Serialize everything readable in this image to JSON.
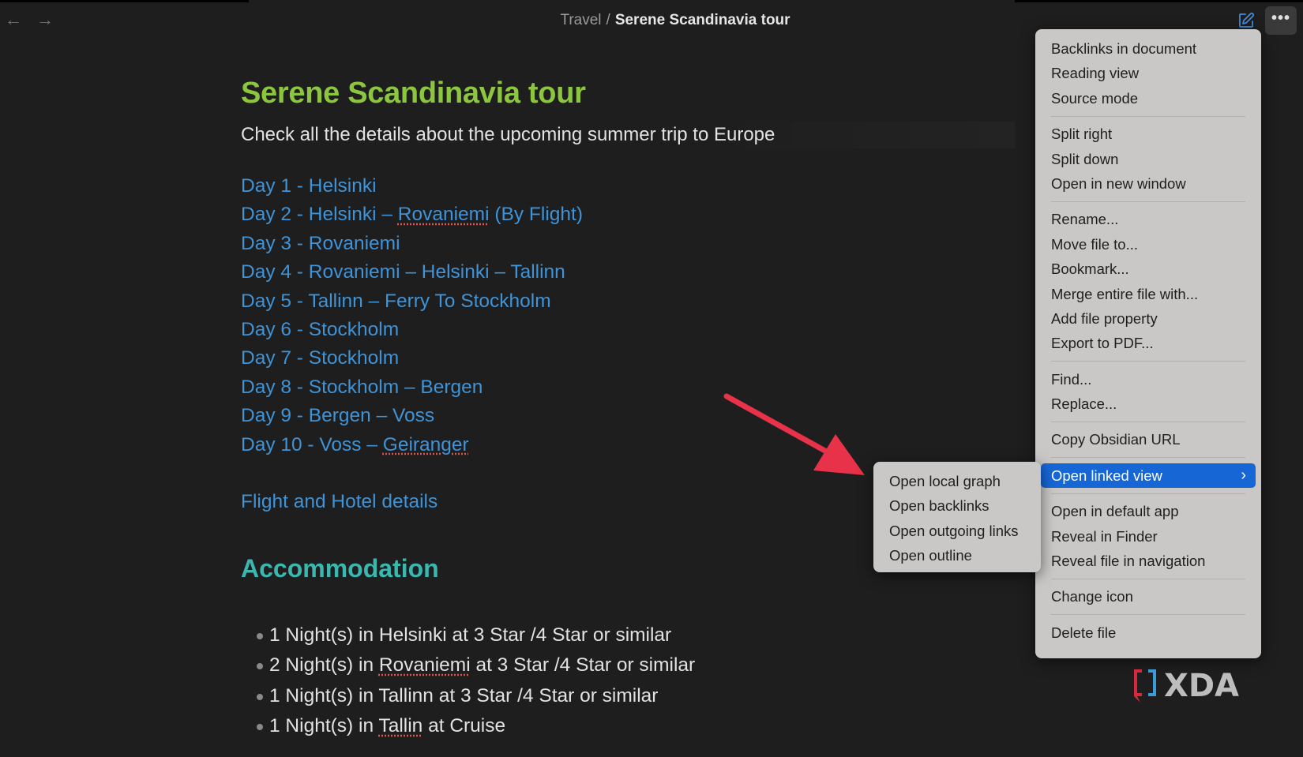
{
  "header": {
    "breadcrumb_folder": "Travel",
    "breadcrumb_sep": "/",
    "breadcrumb_current": "Serene Scandinavia tour",
    "more_label": "•••"
  },
  "note": {
    "title": "Serene Scandinavia tour",
    "subtitle": "Check all the details about the upcoming summer trip to Europe",
    "days": {
      "d1": "Day 1 - Helsinki",
      "d2a": "Day 2 - Helsinki – ",
      "d2b": "Rovaniemi",
      "d2c": " (By Flight)",
      "d3": "Day 3 - Rovaniemi",
      "d4": "Day 4 - Rovaniemi – Helsinki – Tallinn",
      "d5": "Day 5 - Tallinn – Ferry To Stockholm",
      "d6": "Day 6 - Stockholm",
      "d7": "Day 7 - Stockholm",
      "d8": "Day 8 - Stockholm – Bergen",
      "d9": "Day 9 - Bergen – Voss",
      "d10a": "Day 10 - Voss – ",
      "d10b": "Geiranger"
    },
    "flight_link": "Flight and Hotel details",
    "accommodation_heading": "Accommodation",
    "accommodation": {
      "a1": "1 Night(s) in Helsinki at 3 Star /4 Star or similar",
      "a2a": "2 Night(s) in ",
      "a2b": "Rovaniemi",
      "a2c": " at 3 Star /4 Star or similar",
      "a3": "1 Night(s) in Tallinn at 3 Star /4 Star or similar",
      "a4a": "1 Night(s) in ",
      "a4b": "Tallin",
      "a4c": " at Cruise"
    }
  },
  "menu": {
    "backlinks": "Backlinks in document",
    "reading_view": "Reading view",
    "source_mode": "Source mode",
    "split_right": "Split right",
    "split_down": "Split down",
    "open_new_window": "Open in new window",
    "rename": "Rename...",
    "move_file": "Move file to...",
    "bookmark": "Bookmark...",
    "merge": "Merge entire file with...",
    "add_property": "Add file property",
    "export_pdf": "Export to PDF...",
    "find": "Find...",
    "replace": "Replace...",
    "copy_url": "Copy Obsidian URL",
    "open_linked_view": "Open linked view",
    "open_default_app": "Open in default app",
    "reveal_finder": "Reveal in Finder",
    "reveal_navigation": "Reveal file in navigation",
    "change_icon": "Change icon",
    "delete_file": "Delete file"
  },
  "submenu": {
    "local_graph": "Open local graph",
    "backlinks": "Open backlinks",
    "outgoing_links": "Open outgoing links",
    "outline": "Open outline"
  },
  "colors": {
    "title": "#8cc63e",
    "link": "#3f93d7",
    "heading2": "#3ab8b0",
    "menu_active": "#1766d6",
    "annotation_arrow": "#e8324a"
  },
  "watermark": {
    "text": "XDA"
  }
}
